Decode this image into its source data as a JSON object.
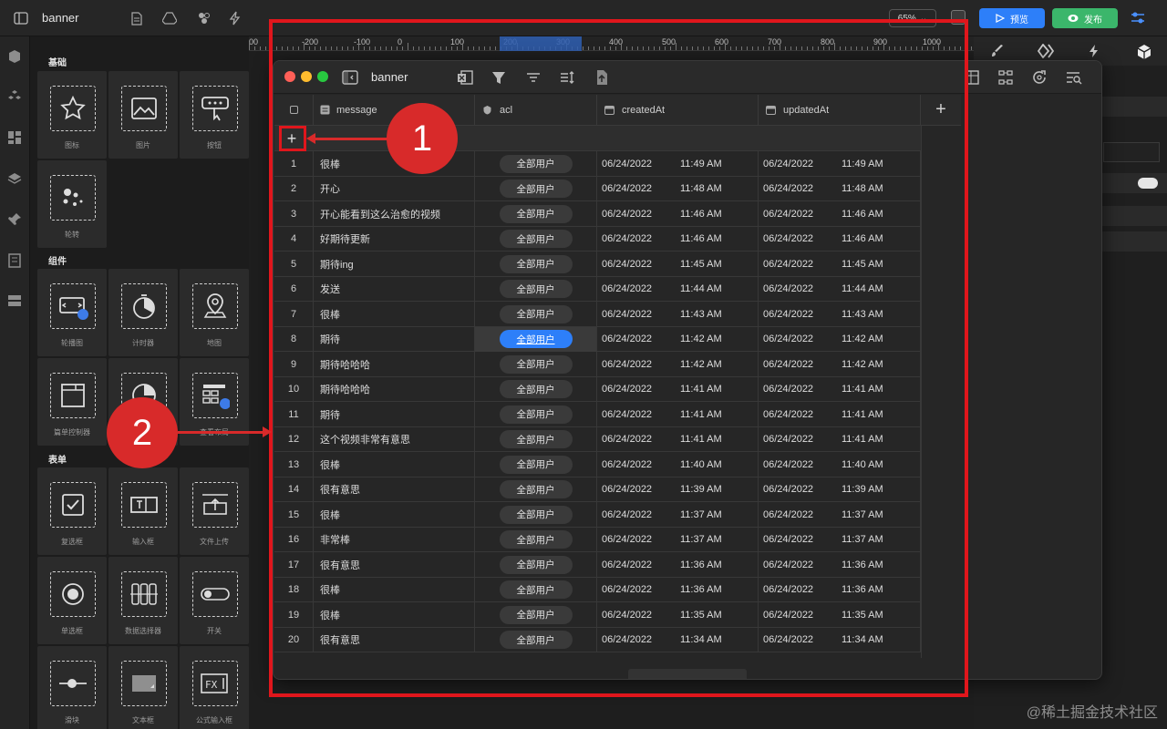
{
  "app": {
    "title": "banner",
    "zoom": "65%",
    "preview_label": "预览",
    "publish_label": "发布"
  },
  "ruler": {
    "labels": [
      "-200",
      "-100",
      "0",
      "100",
      "200",
      "300",
      "400",
      "500",
      "600",
      "700",
      "800",
      "900",
      "1000"
    ],
    "left_partial": "00"
  },
  "panel": {
    "sections": {
      "basic": "基础",
      "components": "组件",
      "forms": "表单"
    },
    "basic_items": [
      "图标",
      "图片",
      "按钮",
      "轮转"
    ],
    "component_items": [
      "轮播图",
      "计时器",
      "地图",
      "篇单控制器",
      "",
      "查看布局"
    ],
    "form_items": [
      "复选框",
      "输入框",
      "文件上传",
      "单选框",
      "数据选择器",
      "开关",
      "滑块",
      "文本框",
      "公式输入框"
    ]
  },
  "window": {
    "title": "banner",
    "columns": [
      "message",
      "acl",
      "createdAt",
      "updatedAt"
    ],
    "rows": [
      {
        "n": "1",
        "message": "很棒",
        "acl": "全部用户",
        "c_date": "06/24/2022",
        "c_time": "11:49 AM",
        "u_date": "06/24/2022",
        "u_time": "11:49 AM"
      },
      {
        "n": "2",
        "message": "开心",
        "acl": "全部用户",
        "c_date": "06/24/2022",
        "c_time": "11:48 AM",
        "u_date": "06/24/2022",
        "u_time": "11:48 AM"
      },
      {
        "n": "3",
        "message": "开心能看到这么治愈的视频",
        "acl": "全部用户",
        "c_date": "06/24/2022",
        "c_time": "11:46 AM",
        "u_date": "06/24/2022",
        "u_time": "11:46 AM"
      },
      {
        "n": "4",
        "message": "好期待更新",
        "acl": "全部用户",
        "c_date": "06/24/2022",
        "c_time": "11:46 AM",
        "u_date": "06/24/2022",
        "u_time": "11:46 AM"
      },
      {
        "n": "5",
        "message": "期待ing",
        "acl": "全部用户",
        "c_date": "06/24/2022",
        "c_time": "11:45 AM",
        "u_date": "06/24/2022",
        "u_time": "11:45 AM"
      },
      {
        "n": "6",
        "message": "发送",
        "acl": "全部用户",
        "c_date": "06/24/2022",
        "c_time": "11:44 AM",
        "u_date": "06/24/2022",
        "u_time": "11:44 AM"
      },
      {
        "n": "7",
        "message": "很棒",
        "acl": "全部用户",
        "c_date": "06/24/2022",
        "c_time": "11:43 AM",
        "u_date": "06/24/2022",
        "u_time": "11:43 AM"
      },
      {
        "n": "8",
        "message": "期待",
        "acl": "全部用户",
        "c_date": "06/24/2022",
        "c_time": "11:42 AM",
        "u_date": "06/24/2022",
        "u_time": "11:42 AM"
      },
      {
        "n": "9",
        "message": "期待哈哈哈",
        "acl": "全部用户",
        "c_date": "06/24/2022",
        "c_time": "11:42 AM",
        "u_date": "06/24/2022",
        "u_time": "11:42 AM"
      },
      {
        "n": "10",
        "message": "期待哈哈哈",
        "acl": "全部用户",
        "c_date": "06/24/2022",
        "c_time": "11:41 AM",
        "u_date": "06/24/2022",
        "u_time": "11:41 AM"
      },
      {
        "n": "11",
        "message": "期待",
        "acl": "全部用户",
        "c_date": "06/24/2022",
        "c_time": "11:41 AM",
        "u_date": "06/24/2022",
        "u_time": "11:41 AM"
      },
      {
        "n": "12",
        "message": "这个视频非常有意思",
        "acl": "全部用户",
        "c_date": "06/24/2022",
        "c_time": "11:41 AM",
        "u_date": "06/24/2022",
        "u_time": "11:41 AM"
      },
      {
        "n": "13",
        "message": "很棒",
        "acl": "全部用户",
        "c_date": "06/24/2022",
        "c_time": "11:40 AM",
        "u_date": "06/24/2022",
        "u_time": "11:40 AM"
      },
      {
        "n": "14",
        "message": "很有意思",
        "acl": "全部用户",
        "c_date": "06/24/2022",
        "c_time": "11:39 AM",
        "u_date": "06/24/2022",
        "u_time": "11:39 AM"
      },
      {
        "n": "15",
        "message": "很棒",
        "acl": "全部用户",
        "c_date": "06/24/2022",
        "c_time": "11:37 AM",
        "u_date": "06/24/2022",
        "u_time": "11:37 AM"
      },
      {
        "n": "16",
        "message": "非常棒",
        "acl": "全部用户",
        "c_date": "06/24/2022",
        "c_time": "11:37 AM",
        "u_date": "06/24/2022",
        "u_time": "11:37 AM"
      },
      {
        "n": "17",
        "message": "很有意思",
        "acl": "全部用户",
        "c_date": "06/24/2022",
        "c_time": "11:36 AM",
        "u_date": "06/24/2022",
        "u_time": "11:36 AM"
      },
      {
        "n": "18",
        "message": "很棒",
        "acl": "全部用户",
        "c_date": "06/24/2022",
        "c_time": "11:36 AM",
        "u_date": "06/24/2022",
        "u_time": "11:36 AM"
      },
      {
        "n": "19",
        "message": "很棒",
        "acl": "全部用户",
        "c_date": "06/24/2022",
        "c_time": "11:35 AM",
        "u_date": "06/24/2022",
        "u_time": "11:35 AM"
      },
      {
        "n": "20",
        "message": "很有意思",
        "acl": "全部用户",
        "c_date": "06/24/2022",
        "c_time": "11:34 AM",
        "u_date": "06/24/2022",
        "u_time": "11:34 AM"
      }
    ],
    "selected_row": "8"
  },
  "annotations": {
    "badge1": "1",
    "badge2": "2",
    "color": "#e0161c"
  },
  "watermark": "@稀土掘金技术社区",
  "colors": {
    "accent_blue": "#2d7ff9",
    "publish_green": "#3bb66b"
  }
}
